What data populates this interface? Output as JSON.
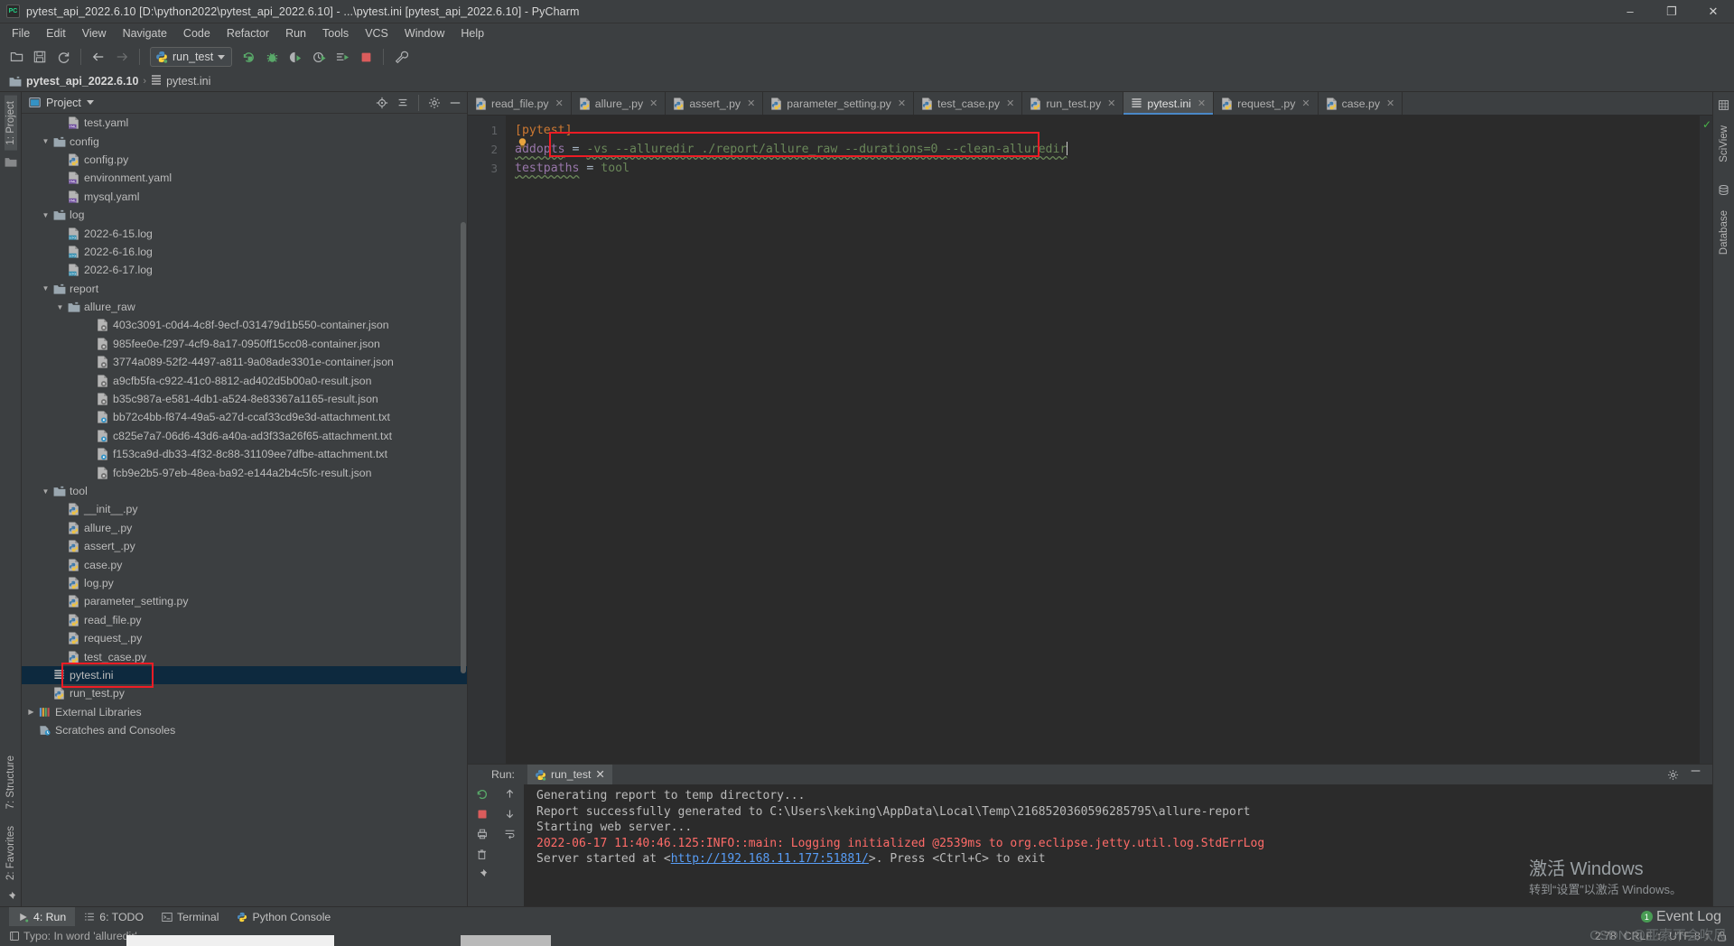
{
  "window": {
    "title": "pytest_api_2022.6.10 [D:\\python2022\\pytest_api_2022.6.10] - ...\\pytest.ini [pytest_api_2022.6.10] - PyCharm",
    "logo_text": "PC",
    "minimize": "–",
    "maximize": "❐",
    "close": "✕"
  },
  "menubar": {
    "items": [
      "File",
      "Edit",
      "View",
      "Navigate",
      "Code",
      "Refactor",
      "Run",
      "Tools",
      "VCS",
      "Window",
      "Help"
    ]
  },
  "toolbar": {
    "run_config_label": "run_test",
    "icons": [
      "open-folder-icon",
      "save-all-icon",
      "sync-icon",
      "back-arrow-icon",
      "forward-arrow-icon",
      "rerun-icon",
      "debug-icon",
      "coverage-icon",
      "profile-icon",
      "run-with-icon",
      "stop-icon",
      "settings-wrench-icon"
    ]
  },
  "navbar": {
    "project": "pytest_api_2022.6.10",
    "separator": "›",
    "file": "pytest.ini"
  },
  "left_strip": {
    "project_tab": "1: Project",
    "structure_tab": "7: Structure",
    "favorites_tab": "2: Favorites"
  },
  "right_strip": {
    "sciview_tab": "SciView",
    "database_tab": "Database"
  },
  "project_panel": {
    "title": "Project",
    "tools": [
      "locate-icon",
      "collapse-all-icon",
      "gear-icon",
      "hide-icon"
    ]
  },
  "tree": [
    {
      "indent": 3,
      "twist": "",
      "icon": "yaml-file-icon",
      "label": "test.yaml"
    },
    {
      "indent": 2,
      "twist": "▼",
      "icon": "folder-icon",
      "label": "config"
    },
    {
      "indent": 3,
      "twist": "",
      "icon": "python-file-icon",
      "label": "config.py"
    },
    {
      "indent": 3,
      "twist": "",
      "icon": "yaml-file-icon",
      "label": "environment.yaml"
    },
    {
      "indent": 3,
      "twist": "",
      "icon": "yaml-file-icon",
      "label": "mysql.yaml"
    },
    {
      "indent": 2,
      "twist": "▼",
      "icon": "folder-icon",
      "label": "log"
    },
    {
      "indent": 3,
      "twist": "",
      "icon": "log-file-icon",
      "label": "2022-6-15.log"
    },
    {
      "indent": 3,
      "twist": "",
      "icon": "log-file-icon",
      "label": "2022-6-16.log"
    },
    {
      "indent": 3,
      "twist": "",
      "icon": "log-file-icon",
      "label": "2022-6-17.log"
    },
    {
      "indent": 2,
      "twist": "▼",
      "icon": "folder-icon",
      "label": "report"
    },
    {
      "indent": 3,
      "twist": "▼",
      "icon": "folder-icon",
      "label": "allure_raw"
    },
    {
      "indent": 5,
      "twist": "",
      "icon": "json-file-icon",
      "label": "403c3091-c0d4-4c8f-9ecf-031479d1b550-container.json"
    },
    {
      "indent": 5,
      "twist": "",
      "icon": "json-file-icon",
      "label": "985fee0e-f297-4cf9-8a17-0950ff15cc08-container.json"
    },
    {
      "indent": 5,
      "twist": "",
      "icon": "json-file-icon",
      "label": "3774a089-52f2-4497-a811-9a08ade3301e-container.json"
    },
    {
      "indent": 5,
      "twist": "",
      "icon": "json-file-icon",
      "label": "a9cfb5fa-c922-41c0-8812-ad402d5b00a0-result.json"
    },
    {
      "indent": 5,
      "twist": "",
      "icon": "json-file-icon",
      "label": "b35c987a-e581-4db1-a524-8e83367a1165-result.json"
    },
    {
      "indent": 5,
      "twist": "",
      "icon": "txt-file-icon",
      "label": "bb72c4bb-f874-49a5-a27d-ccaf33cd9e3d-attachment.txt"
    },
    {
      "indent": 5,
      "twist": "",
      "icon": "txt-file-icon",
      "label": "c825e7a7-06d6-43d6-a40a-ad3f33a26f65-attachment.txt"
    },
    {
      "indent": 5,
      "twist": "",
      "icon": "txt-file-icon",
      "label": "f153ca9d-db33-4f32-8c88-31109ee7dfbe-attachment.txt"
    },
    {
      "indent": 5,
      "twist": "",
      "icon": "json-file-icon",
      "label": "fcb9e2b5-97eb-48ea-ba92-e144a2b4c5fc-result.json"
    },
    {
      "indent": 2,
      "twist": "▼",
      "icon": "folder-icon",
      "label": "tool"
    },
    {
      "indent": 3,
      "twist": "",
      "icon": "python-file-icon",
      "label": "__init__.py"
    },
    {
      "indent": 3,
      "twist": "",
      "icon": "python-file-icon",
      "label": "allure_.py"
    },
    {
      "indent": 3,
      "twist": "",
      "icon": "python-file-icon",
      "label": "assert_.py"
    },
    {
      "indent": 3,
      "twist": "",
      "icon": "python-file-icon",
      "label": "case.py"
    },
    {
      "indent": 3,
      "twist": "",
      "icon": "python-file-icon",
      "label": "log.py"
    },
    {
      "indent": 3,
      "twist": "",
      "icon": "python-file-icon",
      "label": "parameter_setting.py"
    },
    {
      "indent": 3,
      "twist": "",
      "icon": "python-file-icon",
      "label": "read_file.py"
    },
    {
      "indent": 3,
      "twist": "",
      "icon": "python-file-icon",
      "label": "request_.py"
    },
    {
      "indent": 3,
      "twist": "",
      "icon": "python-file-icon",
      "label": "test_case.py"
    },
    {
      "indent": 2,
      "twist": "",
      "icon": "ini-file-icon",
      "label": "pytest.ini",
      "selected": true
    },
    {
      "indent": 2,
      "twist": "",
      "icon": "python-file-icon",
      "label": "run_test.py"
    },
    {
      "indent": 1,
      "twist": "▶",
      "icon": "libraries-icon",
      "label": "External Libraries"
    },
    {
      "indent": 1,
      "twist": "",
      "icon": "scratches-icon",
      "label": "Scratches and Consoles"
    }
  ],
  "editor_tabs": [
    {
      "label": "read_file.py",
      "icon": "python-file-icon",
      "active": false
    },
    {
      "label": "allure_.py",
      "icon": "python-file-icon",
      "active": false
    },
    {
      "label": "assert_.py",
      "icon": "python-file-icon",
      "active": false
    },
    {
      "label": "parameter_setting.py",
      "icon": "python-file-icon",
      "active": false
    },
    {
      "label": "test_case.py",
      "icon": "python-file-icon",
      "active": false
    },
    {
      "label": "run_test.py",
      "icon": "python-file-icon",
      "active": false
    },
    {
      "label": "pytest.ini",
      "icon": "ini-file-icon",
      "active": true
    },
    {
      "label": "request_.py",
      "icon": "python-file-icon",
      "active": false
    },
    {
      "label": "case.py",
      "icon": "python-file-icon",
      "active": false
    }
  ],
  "editor": {
    "line_numbers": [
      "1",
      "2",
      "3"
    ],
    "line1_section": "[pytest]",
    "line2_key": "addopts",
    "line2_eq": " = ",
    "line2_value": "-vs --alluredir ./report/allure_raw --durations=0 --clean-alluredir",
    "line3_key": "testpaths",
    "line3_eq": " = ",
    "line3_value": "tool",
    "highlight_color": "#ee1c25"
  },
  "run_window": {
    "run_label": "Run:",
    "tab_label": "run_test",
    "close": "✕",
    "console_lines": [
      {
        "text": "Generating report to temp directory...",
        "style": "normal"
      },
      {
        "text": "Report successfully generated to C:\\Users\\keking\\AppData\\Local\\Temp\\2168520360596285795\\allure-report",
        "style": "normal"
      },
      {
        "text": "Starting web server...",
        "style": "normal"
      },
      {
        "text": "2022-06-17 11:40:46.125:INFO::main: Logging initialized @2539ms to org.eclipse.jetty.util.log.StdErrLog",
        "style": "error"
      }
    ],
    "last_line_prefix": "Server started at <",
    "last_line_link": "http://192.168.11.177:51881/",
    "last_line_suffix": ">. Press <Ctrl+C> to exit"
  },
  "bottom_tabs": [
    {
      "label": "4: Run",
      "icon": "run-icon",
      "active": true
    },
    {
      "label": "6: TODO",
      "icon": "todo-icon",
      "active": false
    },
    {
      "label": "Terminal",
      "icon": "terminal-icon",
      "active": false
    },
    {
      "label": "Python Console",
      "icon": "python-icon",
      "active": false
    }
  ],
  "status_bar": {
    "inspection_text": "Typo: In word 'alluredir'",
    "caret_position": "2:78",
    "line_separator": "CRLF",
    "line_separator_caret": "↕",
    "encoding": "UTF-8",
    "encoding_caret": "↕",
    "event_log": "Event Log",
    "event_log_count": "1"
  },
  "watermarks": {
    "windows_activate_title": "激活 Windows",
    "windows_activate_sub": "转到“设置”以激活 Windows。",
    "csdn": "CSDN @亚索不会吹风"
  }
}
